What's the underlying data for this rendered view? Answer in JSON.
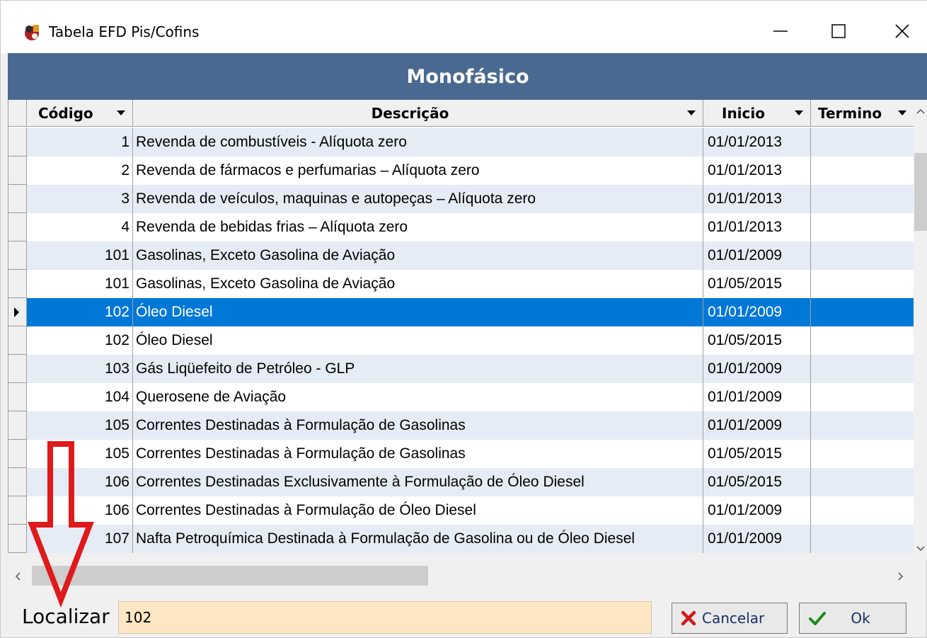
{
  "window": {
    "title": "Tabela EFD Pis/Cofins"
  },
  "header": {
    "title": "Monofásico"
  },
  "columns": {
    "codigo": "Código",
    "descricao": "Descrição",
    "inicio": "Inicio",
    "termino": "Termino"
  },
  "rows": [
    {
      "codigo": "1",
      "descricao": "Revenda de combustíveis - Alíquota zero",
      "inicio": "01/01/2013",
      "termino": ""
    },
    {
      "codigo": "2",
      "descricao": "Revenda de fármacos e perfumarias – Alíquota zero",
      "inicio": "01/01/2013",
      "termino": ""
    },
    {
      "codigo": "3",
      "descricao": "Revenda de veículos, maquinas e autopeças – Alíquota zero",
      "inicio": "01/01/2013",
      "termino": ""
    },
    {
      "codigo": "4",
      "descricao": "Revenda de bebidas frias – Alíquota zero",
      "inicio": "01/01/2013",
      "termino": ""
    },
    {
      "codigo": "101",
      "descricao": "Gasolinas, Exceto Gasolina de Aviação",
      "inicio": "01/01/2009",
      "termino": ""
    },
    {
      "codigo": "101",
      "descricao": "Gasolinas, Exceto Gasolina de Aviação",
      "inicio": "01/05/2015",
      "termino": ""
    },
    {
      "codigo": "102",
      "descricao": "Óleo Diesel",
      "inicio": "01/01/2009",
      "termino": "",
      "selected": true
    },
    {
      "codigo": "102",
      "descricao": "Óleo Diesel",
      "inicio": "01/05/2015",
      "termino": ""
    },
    {
      "codigo": "103",
      "descricao": "Gás Liqüefeito de Petróleo - GLP",
      "inicio": "01/01/2009",
      "termino": ""
    },
    {
      "codigo": "104",
      "descricao": "Querosene de Aviação",
      "inicio": "01/01/2009",
      "termino": ""
    },
    {
      "codigo": "105",
      "descricao": "Correntes Destinadas à Formulação de Gasolinas",
      "inicio": "01/01/2009",
      "termino": ""
    },
    {
      "codigo": "105",
      "descricao": "Correntes Destinadas à Formulação de Gasolinas",
      "inicio": "01/05/2015",
      "termino": ""
    },
    {
      "codigo": "106",
      "descricao": "Correntes Destinadas Exclusivamente à Formulação de Óleo Diesel",
      "inicio": "01/05/2015",
      "termino": ""
    },
    {
      "codigo": "106",
      "descricao": "Correntes Destinadas à Formulação de Óleo Diesel",
      "inicio": "01/01/2009",
      "termino": ""
    },
    {
      "codigo": "107",
      "descricao": "Nafta Petroquímica Destinada à Formulação de Gasolina ou de Óleo Diesel",
      "inicio": "01/01/2009",
      "termino": ""
    }
  ],
  "search": {
    "label": "Localizar",
    "value": "102"
  },
  "buttons": {
    "cancel": "Cancelar",
    "ok": "Ok"
  },
  "colors": {
    "header_bg": "#4a6991",
    "selection": "#0078d7",
    "row_alt": "#e6ecf6",
    "search_bg": "#fde6c4",
    "annotation_arrow": "#e0191b"
  }
}
